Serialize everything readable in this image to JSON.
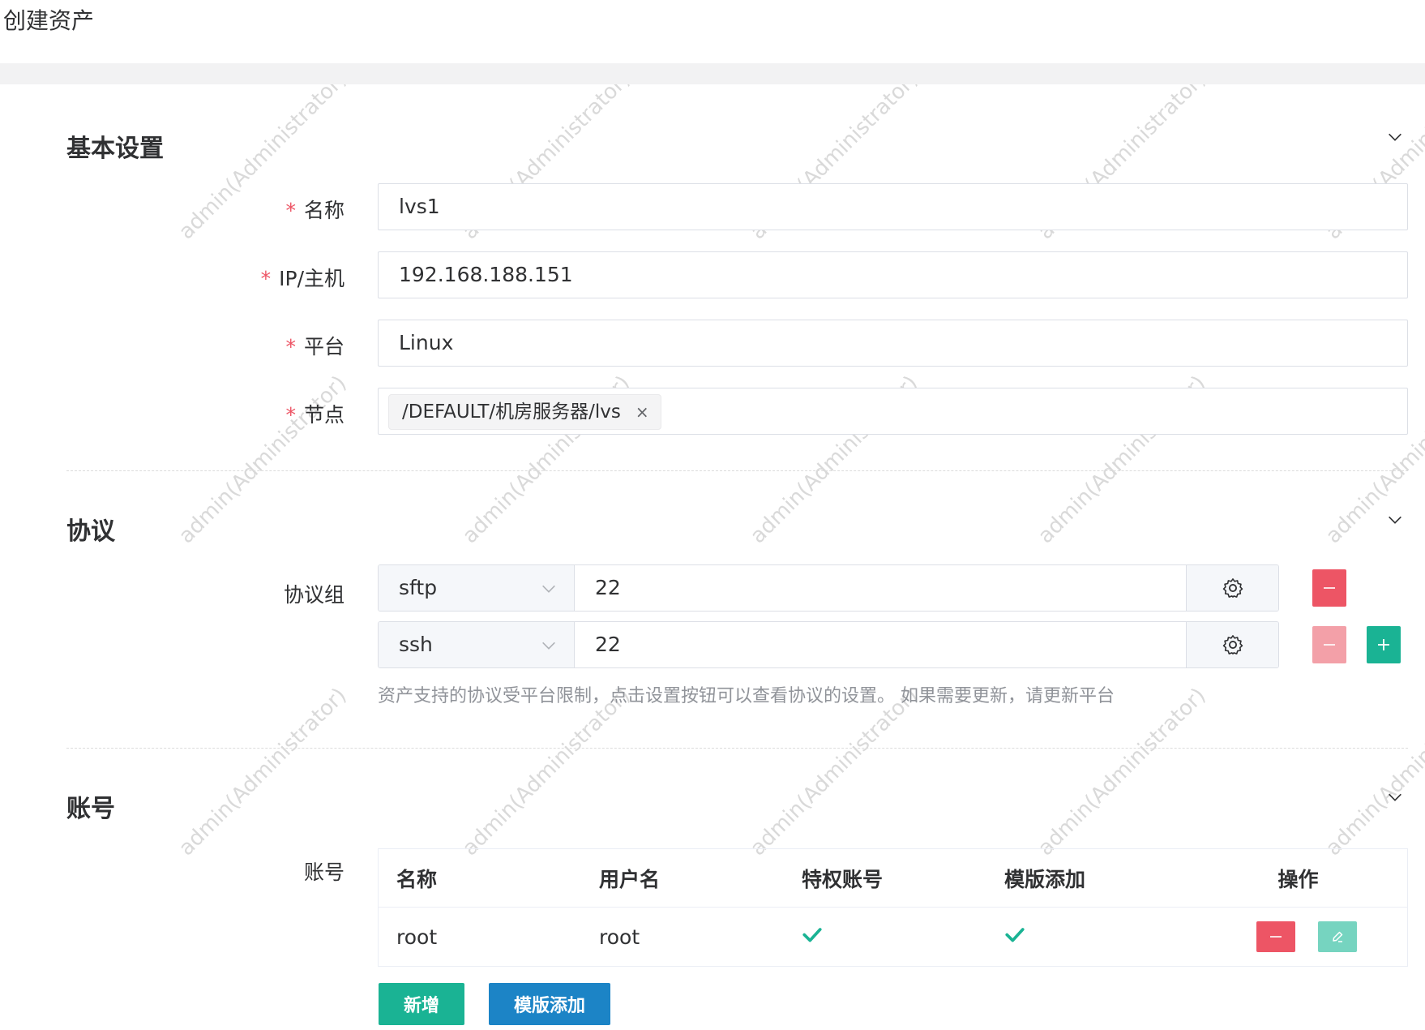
{
  "page": {
    "title": "创建资产"
  },
  "watermark": {
    "text": "admin(Administrator)"
  },
  "sections": {
    "basic": {
      "title": "基本设置"
    },
    "protocol": {
      "title": "协议"
    },
    "account": {
      "title": "账号"
    }
  },
  "basic": {
    "name": {
      "label": "名称",
      "value": "lvs1",
      "required": "*"
    },
    "ip": {
      "label": "IP/主机",
      "value": "192.168.188.151",
      "required": "*"
    },
    "platform": {
      "label": "平台",
      "value": "Linux",
      "required": "*"
    },
    "node": {
      "label": "节点",
      "tag": "/DEFAULT/机房服务器/lvs",
      "tag_close": "×",
      "required": "*"
    }
  },
  "protocol": {
    "label": "协议组",
    "rows": [
      {
        "protocol": "sftp",
        "port": "22"
      },
      {
        "protocol": "ssh",
        "port": "22"
      }
    ],
    "help": "资产支持的协议受平台限制，点击设置按钮可以查看协议的设置。 如果需要更新，请更新平台"
  },
  "account": {
    "label": "账号",
    "columns": [
      "名称",
      "用户名",
      "特权账号",
      "模版添加",
      "操作"
    ],
    "rows": [
      {
        "name": "root",
        "username": "root",
        "privileged": true,
        "template": true
      }
    ],
    "add_button": "新增",
    "template_button": "模版添加"
  },
  "colors": {
    "danger": "#ed5565",
    "primary": "#1ab394",
    "info": "#1c84c6"
  }
}
